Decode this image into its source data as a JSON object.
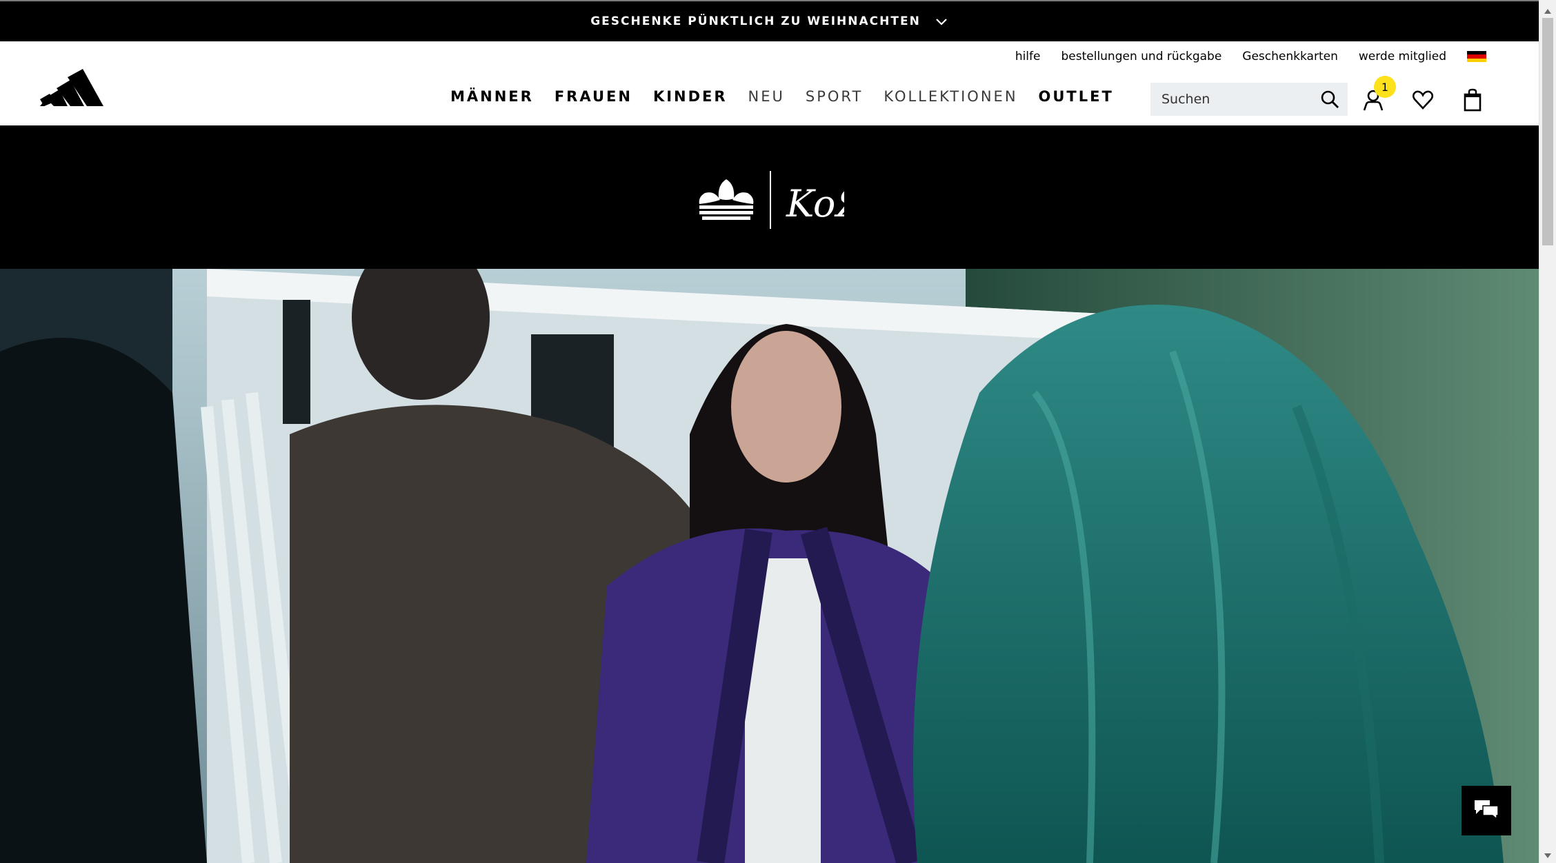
{
  "promo": {
    "text": "GESCHENKE PÜNKTLICH ZU WEIHNACHTEN",
    "chevron_icon": "chevron-down-icon"
  },
  "header": {
    "logo": "adidas-logo",
    "util_links": [
      "hilfe",
      "bestellungen und rückgabe",
      "Geschenkkarten",
      "werde mitglied"
    ],
    "flag": "germany-flag-icon",
    "nav": [
      {
        "label": "MÄNNER",
        "style": "bold"
      },
      {
        "label": "FRAUEN",
        "style": "bold"
      },
      {
        "label": "KINDER",
        "style": "bold"
      },
      {
        "label": "NEU",
        "style": "light"
      },
      {
        "label": "SPORT",
        "style": "light"
      },
      {
        "label": "KOLLEKTIONEN",
        "style": "light"
      },
      {
        "label": "OUTLET",
        "style": "bold"
      }
    ],
    "search": {
      "placeholder": "Suchen",
      "icon": "search-icon"
    },
    "account": {
      "icon": "user-icon",
      "badge_count": "1"
    },
    "wishlist_icon": "heart-icon",
    "cart_icon": "bag-icon"
  },
  "collab": {
    "logo_left": "adidas-trefoil-logo",
    "logo_right": "KoЯn"
  },
  "hero": {
    "image": "campaign-photo-four-people-track-jackets"
  },
  "chat": {
    "icon": "chat-icon"
  },
  "colors": {
    "black": "#000000",
    "badge": "#fde11b",
    "search_bg": "#eceff1",
    "flag_black": "#000000",
    "flag_red": "#dd0000",
    "flag_gold": "#ffce00"
  }
}
